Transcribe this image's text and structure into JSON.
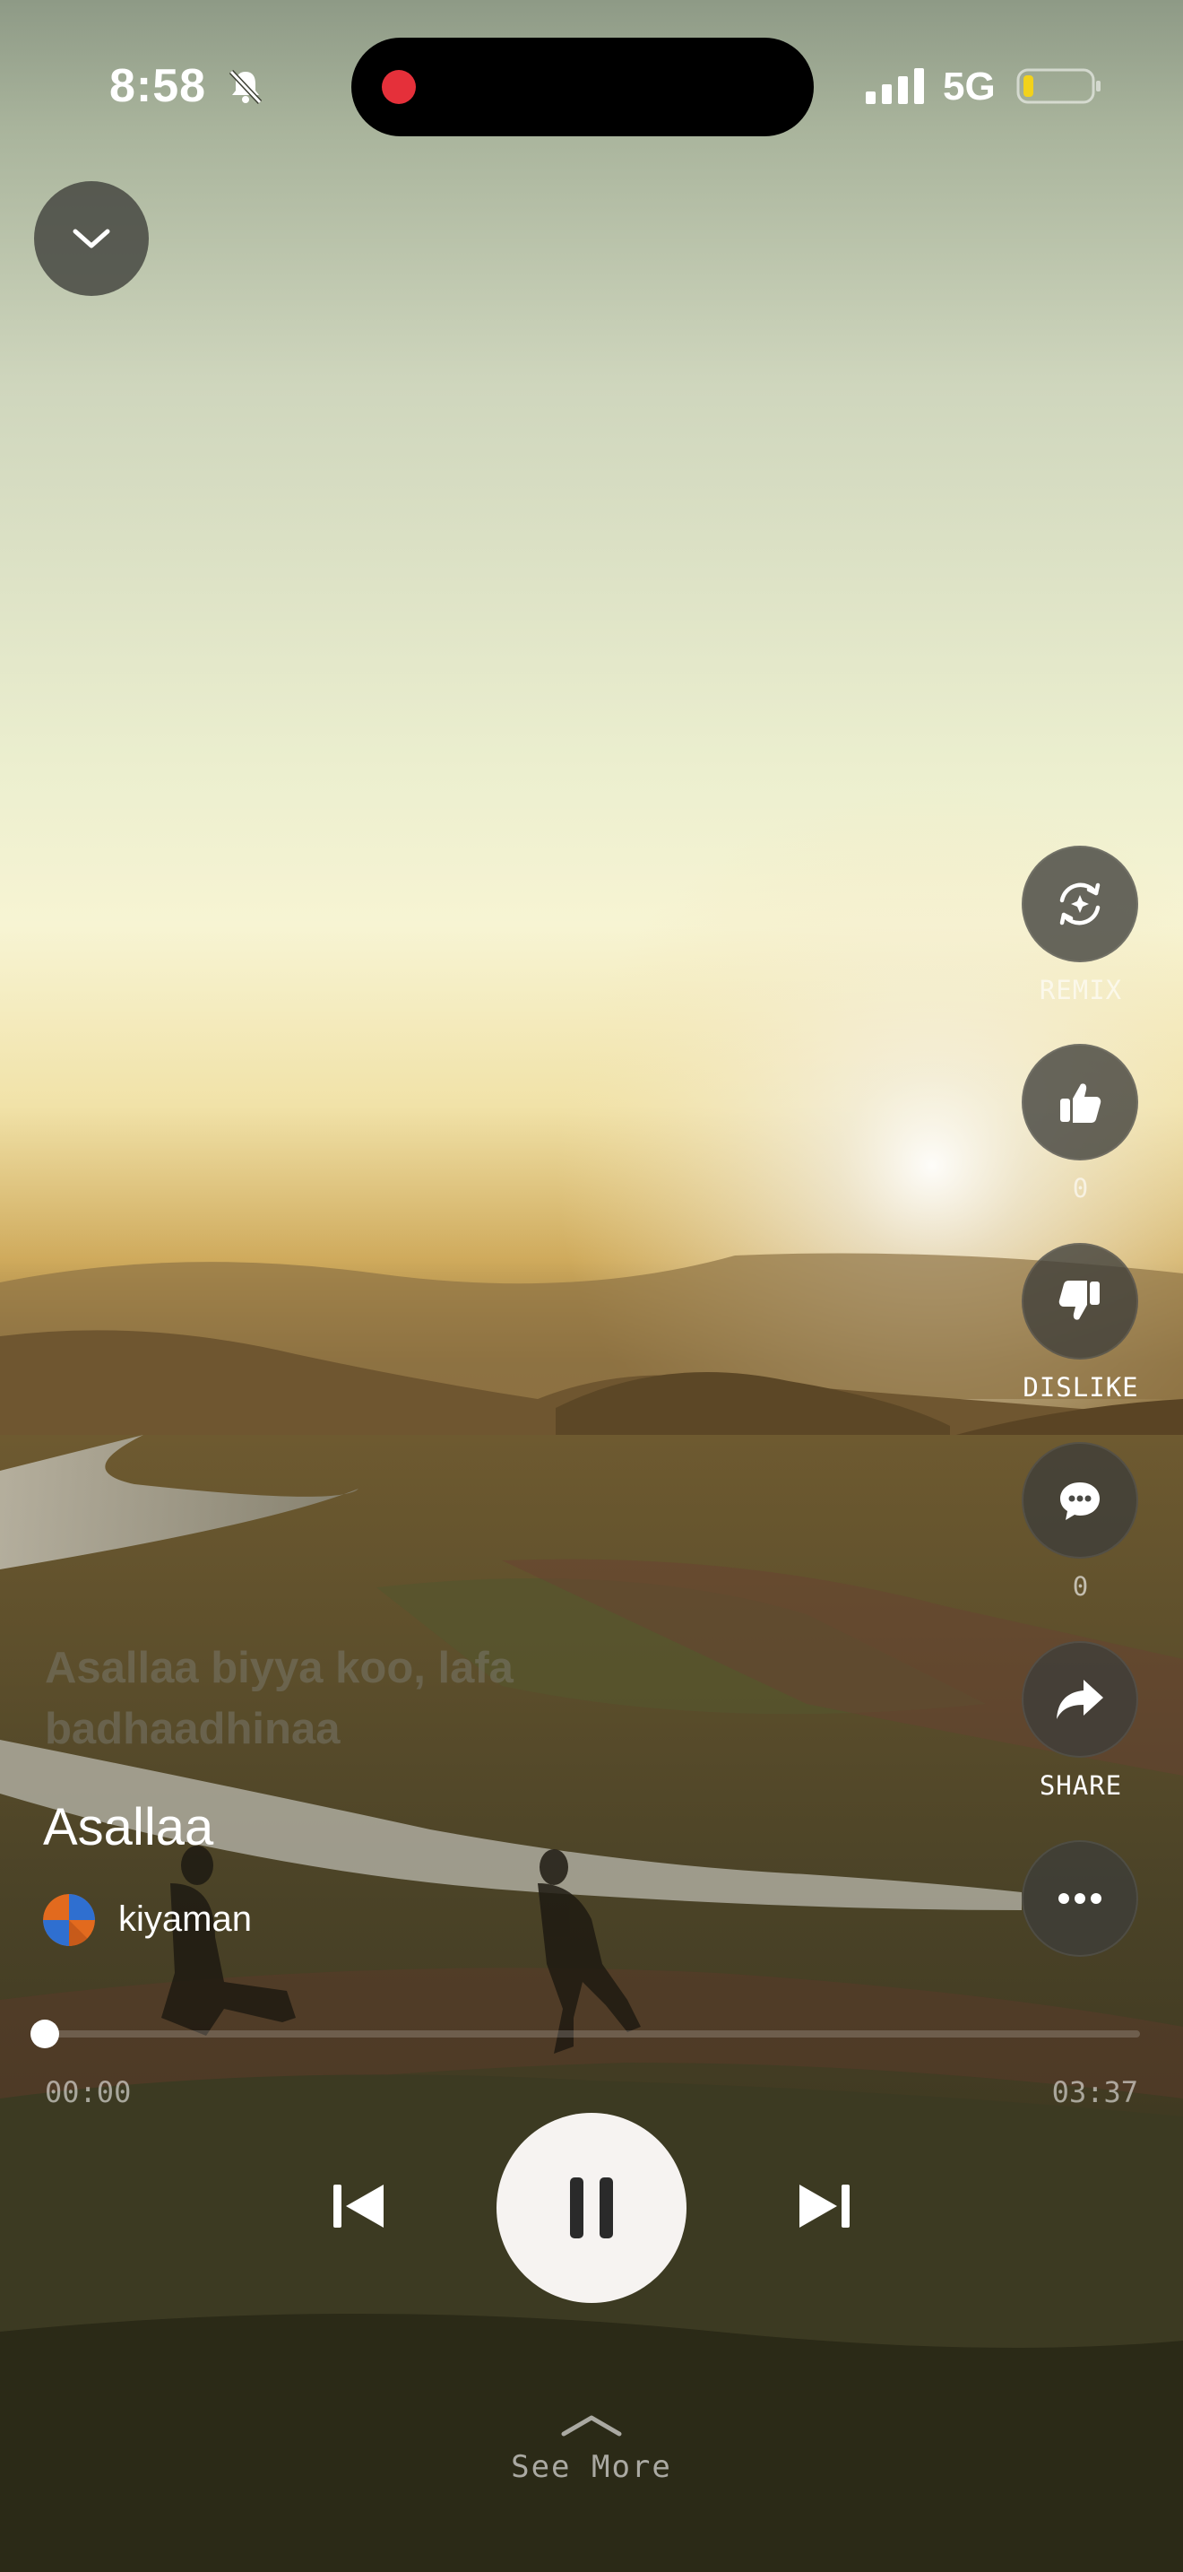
{
  "status_bar": {
    "time": "8:58",
    "network": "5G",
    "icons": [
      "bell-slash-icon",
      "recording-dot-icon",
      "signal-bars-icon",
      "battery-low-icon"
    ]
  },
  "player": {
    "collapse_icon": "chevron-down-icon",
    "lyrics_line": "Asallaa biyya koo, lafa badhaadhinaa",
    "song_title": "Asallaa",
    "artist": "kiyaman",
    "elapsed": "00:00",
    "duration": "03:37",
    "progress_fraction": 0.0,
    "controls": {
      "previous_icon": "skip-previous-icon",
      "play_pause_icon": "pause-icon",
      "next_icon": "skip-next-icon"
    },
    "see_more": "See More"
  },
  "actions": {
    "remix": {
      "label": "REMIX",
      "icon": "remix-sparkle-icon"
    },
    "like": {
      "count": "0",
      "icon": "thumbs-up-icon"
    },
    "dislike": {
      "label": "DISLIKE",
      "icon": "thumbs-down-icon"
    },
    "comment": {
      "count": "0",
      "icon": "comment-icon"
    },
    "share": {
      "label": "SHARE",
      "icon": "share-arrow-icon"
    },
    "more": {
      "icon": "more-dots-icon"
    }
  },
  "colors": {
    "record_red": "#e5303a",
    "battery_low": "#f2d21b",
    "play_button": "#f6f3f1"
  }
}
